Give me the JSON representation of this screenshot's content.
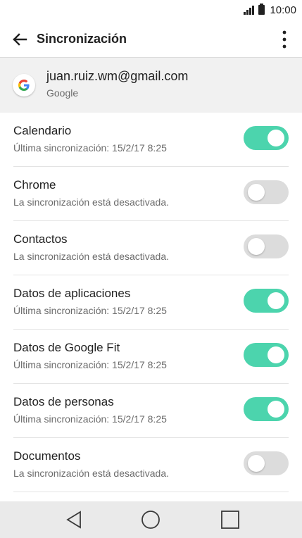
{
  "status_bar": {
    "time": "10:00"
  },
  "app_bar": {
    "title": "Sincronización"
  },
  "account": {
    "email": "juan.ruiz.wm@gmail.com",
    "type": "Google"
  },
  "sync_items": [
    {
      "title": "Calendario",
      "subtitle": "Última sincronización: 15/2/17 8:25",
      "enabled": true
    },
    {
      "title": "Chrome",
      "subtitle": "La sincronización está desactivada.",
      "enabled": false
    },
    {
      "title": "Contactos",
      "subtitle": "La sincronización está desactivada.",
      "enabled": false
    },
    {
      "title": "Datos de aplicaciones",
      "subtitle": "Última sincronización: 15/2/17 8:25",
      "enabled": true
    },
    {
      "title": "Datos de Google Fit",
      "subtitle": "Última sincronización: 15/2/17 8:25",
      "enabled": true
    },
    {
      "title": "Datos de personas",
      "subtitle": "Última sincronización: 15/2/17 8:25",
      "enabled": true
    },
    {
      "title": "Documentos",
      "subtitle": "La sincronización está desactivada.",
      "enabled": false
    }
  ],
  "colors": {
    "toggle_on": "#4cd4ad",
    "toggle_off": "#dcdcdc",
    "header_bg": "#f1f1f1",
    "nav_bg": "#eaeaea"
  },
  "icons": {
    "back": "arrow-left-icon",
    "overflow": "more-vertical-icon",
    "account": "google-logo-icon",
    "nav_back": "triangle-back-icon",
    "nav_home": "circle-home-icon",
    "nav_recents": "square-recents-icon"
  }
}
